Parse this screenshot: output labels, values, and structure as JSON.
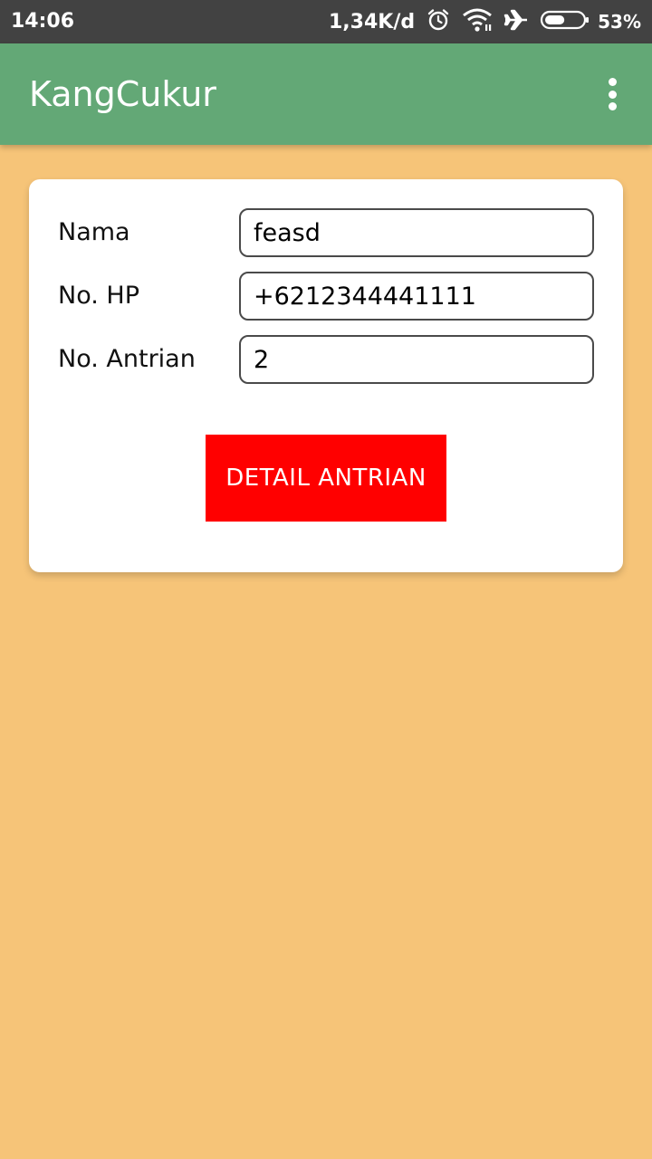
{
  "status_bar": {
    "time": "14:06",
    "net_speed": "1,34K/d",
    "battery_percent": "53%",
    "battery_level": 0.53,
    "icons": [
      "alarm-icon",
      "wifi-icon",
      "airplane-icon",
      "battery-icon"
    ]
  },
  "app_bar": {
    "title": "KangCukur",
    "menu_icon": "overflow-menu-icon",
    "background_color": "#63A876"
  },
  "form": {
    "fields": [
      {
        "label": "Nama",
        "value": "feasd"
      },
      {
        "label": "No. HP",
        "value": "+6212344441111"
      },
      {
        "label": "No. Antrian",
        "value": "2"
      }
    ],
    "button_label": "DETAIL ANTRIAN",
    "button_color": "#FF0000"
  },
  "colors": {
    "page_background": "#F6C478",
    "status_bar": "#424242",
    "card": "#FFFFFF"
  }
}
